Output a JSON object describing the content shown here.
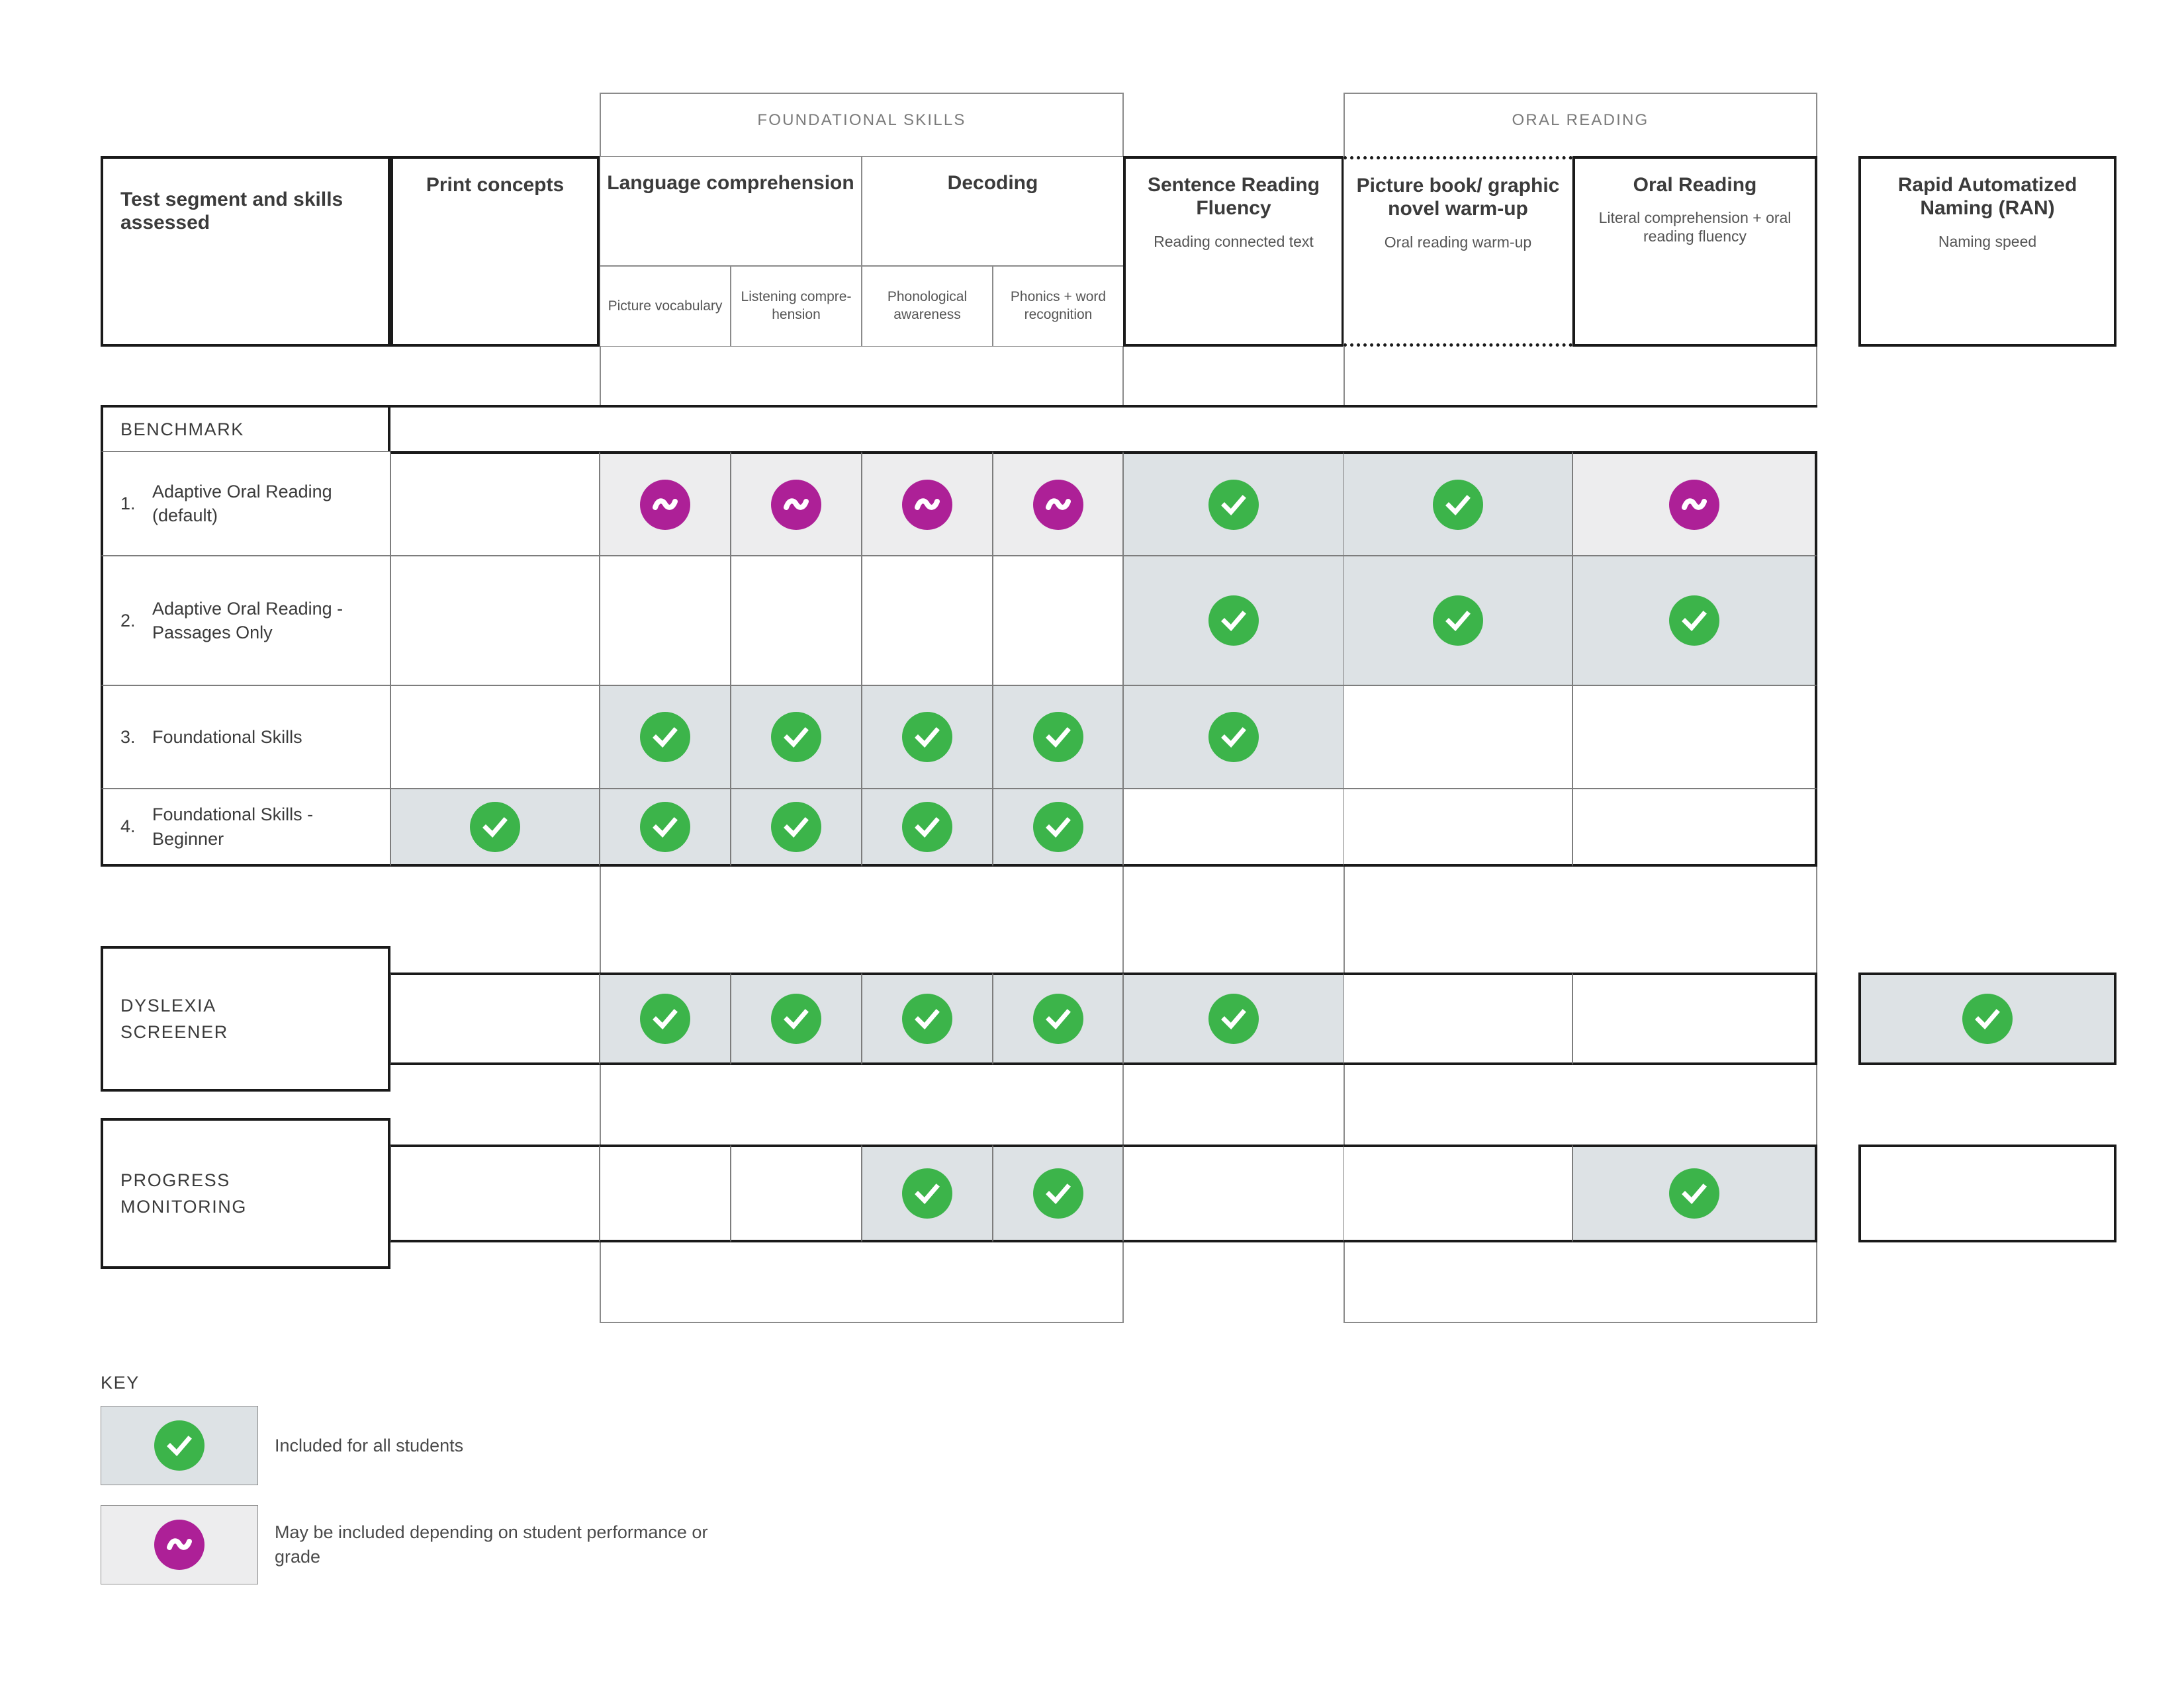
{
  "groups": [
    {
      "id": "foundational",
      "label": "FOUNDATIONAL SKILLS"
    },
    {
      "id": "oral",
      "label": "ORAL READING"
    }
  ],
  "header": {
    "row_label_column": {
      "title": "Test segment and skills assessed"
    },
    "columns": [
      {
        "id": "print_concepts",
        "title": "Print concepts",
        "sub": ""
      },
      {
        "id": "lang_comp",
        "title": "Language comprehension",
        "sub": ""
      },
      {
        "id": "decoding",
        "title": "Decoding",
        "sub": ""
      },
      {
        "id": "srf",
        "title": "Sentence Reading Fluency",
        "sub": "Reading connected text"
      },
      {
        "id": "warmup",
        "title": "Picture book/ graphic novel warm-up",
        "sub": "Oral reading warm-up"
      },
      {
        "id": "oral_reading",
        "title": "Oral Reading",
        "sub": "Literal comprehension + oral reading fluency"
      },
      {
        "id": "ran",
        "title": "Rapid Automatized Naming (RAN)",
        "sub": "Naming speed"
      }
    ],
    "subcolumns": [
      {
        "id": "picture_vocab",
        "label": "Picture vocabulary"
      },
      {
        "id": "listening_comp",
        "label": "Listening compre- hension"
      },
      {
        "id": "phono_aware",
        "label": "Phonological awareness"
      },
      {
        "id": "phonics_word",
        "label": "Phonics + word recognition"
      }
    ]
  },
  "sections": [
    {
      "id": "benchmark",
      "label": "BENCHMARK",
      "rows": [
        {
          "num": "1.",
          "label": "Adaptive Oral Reading (default)",
          "cells": {
            "print_concepts": "",
            "picture_vocab": "maybe",
            "listening_comp": "maybe",
            "phono_aware": "maybe",
            "phonics_word": "maybe",
            "srf": "check",
            "warmup": "check",
            "oral_reading": "maybe",
            "ran": ""
          }
        },
        {
          "num": "2.",
          "label": "Adaptive Oral Reading - Passages Only",
          "cells": {
            "print_concepts": "",
            "picture_vocab": "",
            "listening_comp": "",
            "phono_aware": "",
            "phonics_word": "",
            "srf": "check",
            "warmup": "check",
            "oral_reading": "check",
            "ran": ""
          }
        },
        {
          "num": "3.",
          "label": "Foundational Skills",
          "cells": {
            "print_concepts": "",
            "picture_vocab": "check",
            "listening_comp": "check",
            "phono_aware": "check",
            "phonics_word": "check",
            "srf": "check",
            "warmup": "",
            "oral_reading": "",
            "ran": ""
          }
        },
        {
          "num": "4.",
          "label": "Foundational Skills - Beginner",
          "cells": {
            "print_concepts": "check",
            "picture_vocab": "check",
            "listening_comp": "check",
            "phono_aware": "check",
            "phonics_word": "check",
            "srf": "",
            "warmup": "",
            "oral_reading": "",
            "ran": ""
          }
        }
      ]
    },
    {
      "id": "dyslexia",
      "label": "DYSLEXIA SCREENER",
      "rows": [
        {
          "num": "",
          "label": "",
          "cells": {
            "print_concepts": "",
            "picture_vocab": "check",
            "listening_comp": "check",
            "phono_aware": "check",
            "phonics_word": "check",
            "srf": "check",
            "warmup": "",
            "oral_reading": "",
            "ran": "check"
          }
        }
      ]
    },
    {
      "id": "progress",
      "label": "PROGRESS MONITORING",
      "rows": [
        {
          "num": "",
          "label": "",
          "cells": {
            "print_concepts": "",
            "picture_vocab": "",
            "listening_comp": "",
            "phono_aware": "check",
            "phonics_word": "check",
            "srf": "",
            "warmup": "",
            "oral_reading": "check",
            "ran": ""
          }
        }
      ]
    }
  ],
  "key": {
    "title": "KEY",
    "items": [
      {
        "marker": "check",
        "label": "Included for all students"
      },
      {
        "marker": "maybe",
        "label": "May be included depending on student performance or grade"
      }
    ]
  },
  "colors": {
    "check_green": "#3cb44a",
    "maybe_magenta": "#ad2097",
    "shade_check": "#dde2e5",
    "shade_maybe": "#ededee",
    "rule_dark": "#1a1a1a",
    "rule_light": "#7d7d7d",
    "group_rule": "#8b8b8b",
    "text": "#3b3b3b"
  }
}
